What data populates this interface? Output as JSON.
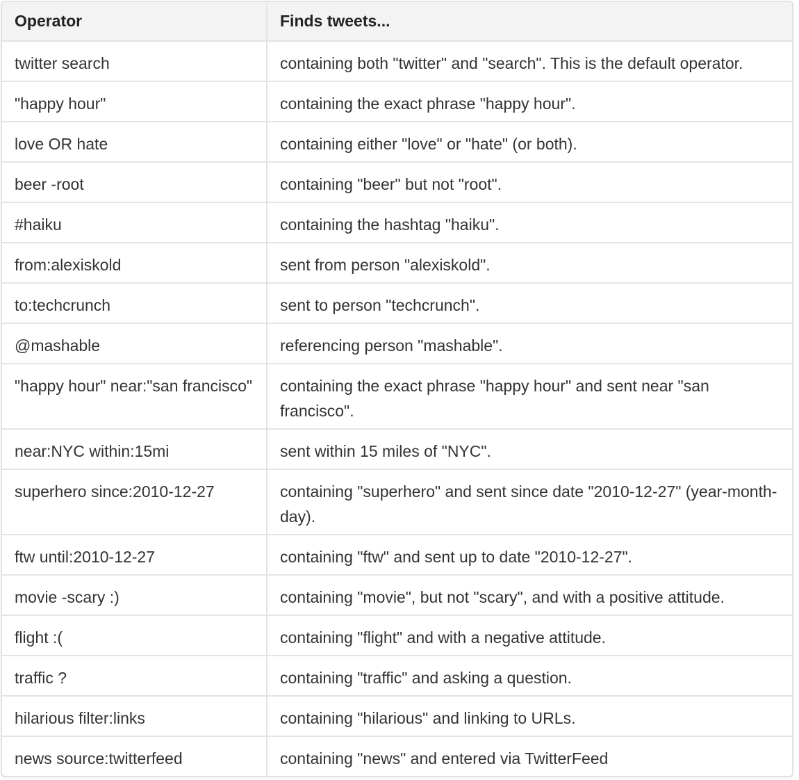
{
  "table": {
    "headers": [
      "Operator",
      "Finds tweets..."
    ],
    "rows": [
      {
        "operator": "twitter search",
        "description": "containing both \"twitter\" and \"search\". This is the default operator."
      },
      {
        "operator": "\"happy hour\"",
        "description": "containing the exact phrase \"happy hour\"."
      },
      {
        "operator": "love OR hate",
        "description": "containing either \"love\" or \"hate\" (or both)."
      },
      {
        "operator": "beer -root",
        "description": "containing \"beer\" but not \"root\"."
      },
      {
        "operator": "#haiku",
        "description": "containing the hashtag \"haiku\"."
      },
      {
        "operator": "from:alexiskold",
        "description": "sent from person \"alexiskold\"."
      },
      {
        "operator": "to:techcrunch",
        "description": "sent to person \"techcrunch\"."
      },
      {
        "operator": "@mashable",
        "description": "referencing person \"mashable\"."
      },
      {
        "operator": "\"happy hour\" near:\"san francisco\"",
        "description": "containing the exact phrase \"happy hour\" and sent near \"san francisco\"."
      },
      {
        "operator": "near:NYC within:15mi",
        "description": "sent within 15 miles of \"NYC\"."
      },
      {
        "operator": "superhero since:2010-12-27",
        "description": "containing \"superhero\" and sent since date \"2010-12-27\" (year-month-day)."
      },
      {
        "operator": "ftw until:2010-12-27",
        "description": "containing \"ftw\" and sent up to date \"2010-12-27\"."
      },
      {
        "operator": "movie -scary :)",
        "description": "containing \"movie\", but not \"scary\", and with a positive attitude."
      },
      {
        "operator": "flight :(",
        "description": "containing \"flight\" and with a negative attitude."
      },
      {
        "operator": "traffic ?",
        "description": "containing \"traffic\" and asking a question."
      },
      {
        "operator": "hilarious filter:links",
        "description": "containing \"hilarious\" and linking to URLs."
      },
      {
        "operator": "news source:twitterfeed",
        "description": "containing \"news\" and entered via TwitterFeed"
      }
    ]
  }
}
